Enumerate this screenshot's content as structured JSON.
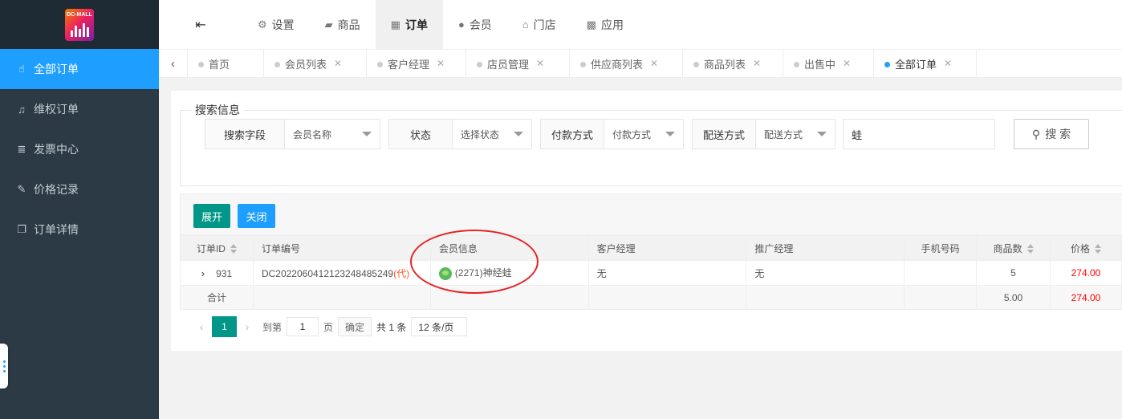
{
  "logo": {
    "text": "DC-MALL"
  },
  "sidebar": {
    "items": [
      {
        "label": "全部订单",
        "icon": "hand-pointer-icon",
        "active": true
      },
      {
        "label": "维权订单",
        "icon": "bell-icon"
      },
      {
        "label": "发票中心",
        "icon": "database-icon"
      },
      {
        "label": "价格记录",
        "icon": "edit-icon"
      },
      {
        "label": "订单详情",
        "icon": "copy-icon"
      }
    ]
  },
  "topnav": {
    "items": [
      {
        "label": "设置",
        "icon": "gears-icon"
      },
      {
        "label": "商品",
        "icon": "shopping-bag-icon"
      },
      {
        "label": "订单",
        "icon": "table-icon",
        "active": true
      },
      {
        "label": "会员",
        "icon": "user-icon"
      },
      {
        "label": "门店",
        "icon": "bank-icon"
      },
      {
        "label": "应用",
        "icon": "grid-icon"
      }
    ]
  },
  "tabs": [
    {
      "label": "首页",
      "closable": false
    },
    {
      "label": "会员列表",
      "closable": true
    },
    {
      "label": "客户经理",
      "closable": true
    },
    {
      "label": "店员管理",
      "closable": true
    },
    {
      "label": "供应商列表",
      "closable": true
    },
    {
      "label": "商品列表",
      "closable": true
    },
    {
      "label": "出售中",
      "closable": true
    },
    {
      "label": "全部订单",
      "closable": true,
      "active": true
    }
  ],
  "search": {
    "legend": "搜索信息",
    "field": {
      "label": "搜索字段",
      "value": "会员名称"
    },
    "status": {
      "label": "状态",
      "value": "选择状态"
    },
    "payment": {
      "label": "付款方式",
      "value": "付款方式"
    },
    "delivery": {
      "label": "配送方式",
      "value": "配送方式"
    },
    "keyword": "蛙",
    "button": "搜 索"
  },
  "toolbar": {
    "expand": "展开",
    "close": "关闭"
  },
  "table": {
    "headers": {
      "id": "订单ID",
      "no": "订单编号",
      "member": "会员信息",
      "manager": "客户经理",
      "promoter": "推广经理",
      "phone": "手机号码",
      "qty": "商品数",
      "price": "价格"
    },
    "row": {
      "id": "931",
      "no": "DC20220604121232484852​49",
      "agent_tag": "(代)",
      "member": "(2271)神经蛙",
      "manager": "无",
      "promoter": "无",
      "phone": "",
      "qty": "5",
      "price": "274.00"
    },
    "total": {
      "label": "合计",
      "qty": "5.00",
      "price": "274.00"
    }
  },
  "pager": {
    "current": "1",
    "goto_label": "到第",
    "goto_value": "1",
    "page_label": "页",
    "confirm": "确定",
    "total": "共 1 条",
    "per_page": "12 条/页"
  },
  "colors": {
    "accent": "#1e9fff",
    "green": "#009688",
    "sidebar": "#2b3a45",
    "price": "#ff0000",
    "highlight_ellipse": "#e52222"
  }
}
